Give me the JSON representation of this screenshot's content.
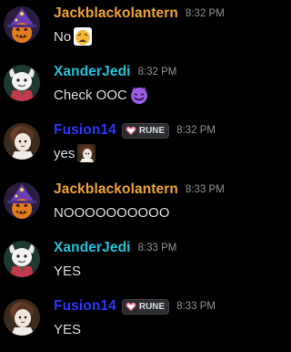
{
  "colors": {
    "background": "#000000",
    "jack_color": "#f0a332",
    "xander_color": "#1fc3d9",
    "fusion_color": "#2a35ff",
    "text": "#dcddde",
    "timestamp": "#8e9297",
    "badge_heart": "#ff7a9a"
  },
  "messages": [
    {
      "author": "Jackblackolantern",
      "time": "8:32 PM",
      "text": "No",
      "emoji": "weary-face-emoji"
    },
    {
      "author": "XanderJedi",
      "time": "8:32 PM",
      "text": "Check OOC",
      "emoji": "smiling-imp-emoji"
    },
    {
      "author": "Fusion14",
      "badge": "RUNE",
      "time": "8:32 PM",
      "text": "yes",
      "emoji": "custom-character-emoji"
    },
    {
      "author": "Jackblackolantern",
      "time": "8:33 PM",
      "text": "NOOOOOOOOOO"
    },
    {
      "author": "XanderJedi",
      "time": "8:33 PM",
      "text": "YES"
    },
    {
      "author": "Fusion14",
      "badge": "RUNE",
      "time": "8:33 PM",
      "text": "YES"
    }
  ]
}
